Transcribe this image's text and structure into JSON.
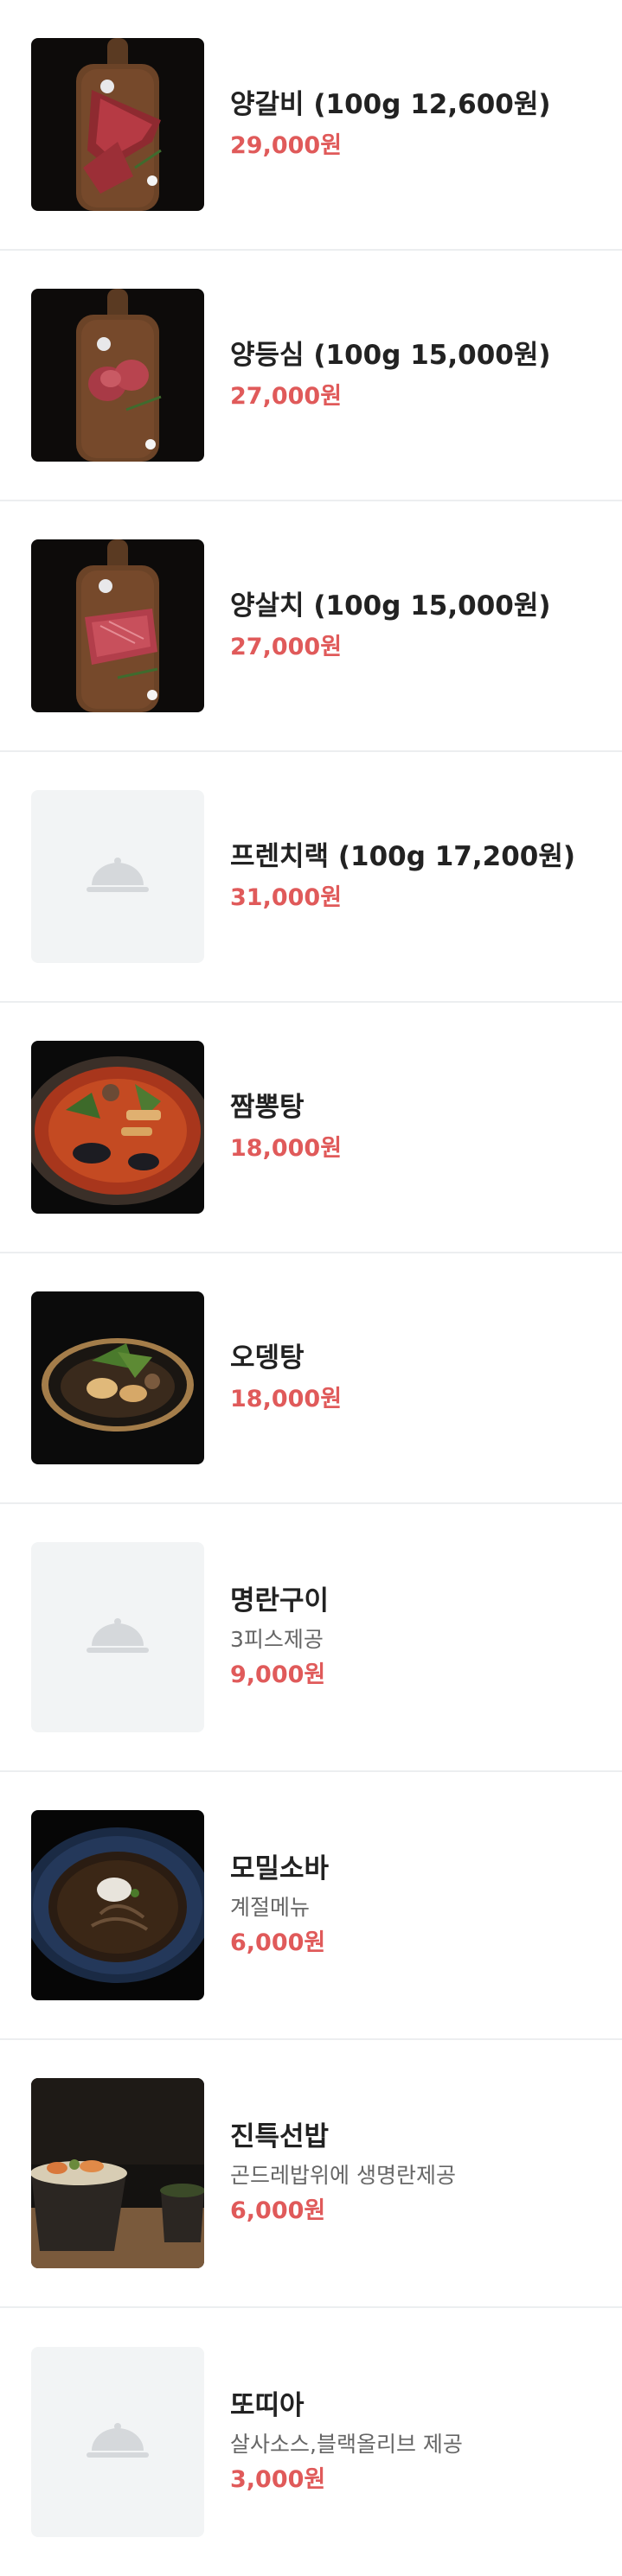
{
  "menu": {
    "items": [
      {
        "name": "양갈비 (100g 12,600원)",
        "price": "29,000원",
        "image": "lamb-ribs-on-board-photo"
      },
      {
        "name": "양등심 (100g 15,000원)",
        "price": "27,000원",
        "image": "lamb-loin-on-board-photo"
      },
      {
        "name": "양살치 (100g 15,000원)",
        "price": "27,000원",
        "image": "lamb-chuck-on-board-photo"
      },
      {
        "name": "프렌치랙 (100g 17,200원)",
        "price": "31,000원",
        "image": "placeholder-cloche-icon"
      },
      {
        "name": "짬뽕탕",
        "price": "18,000원",
        "image": "spicy-seafood-soup-photo"
      },
      {
        "name": "오뎅탕",
        "price": "18,000원",
        "image": "fishcake-soup-photo"
      },
      {
        "name": "명란구이",
        "desc": "3피스제공",
        "price": "9,000원",
        "image": "placeholder-cloche-icon"
      },
      {
        "name": "모밀소바",
        "desc": "계절메뉴",
        "price": "6,000원",
        "image": "cold-soba-photo"
      },
      {
        "name": "진특선밥",
        "desc": "곤드레밥위에 생명란제공",
        "price": "6,000원",
        "image": "rice-bowl-photo"
      },
      {
        "name": "또띠아",
        "desc": "살사소스,블랙올리브 제공",
        "price": "3,000원",
        "image": "placeholder-cloche-icon"
      }
    ]
  },
  "colors": {
    "price": "#e05a5a",
    "name": "#222222",
    "desc": "#666666",
    "divider": "#eceef0",
    "placeholder_bg": "#f2f4f5"
  }
}
